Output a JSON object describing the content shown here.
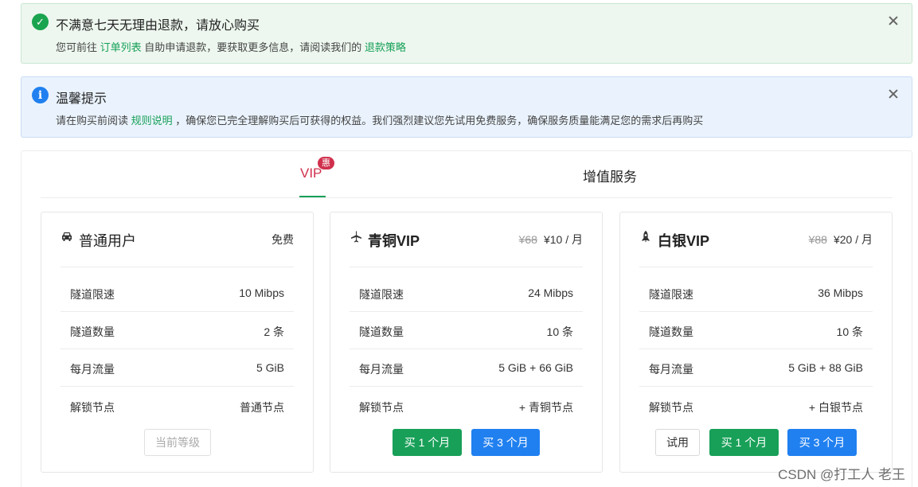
{
  "alerts": {
    "success": {
      "title": "不满意七天无理由退款，请放心购买",
      "desc_1": "您可前往",
      "link_1": "订单列表",
      "desc_2": "自助申请退款，要获取更多信息，请阅读我们的",
      "link_2": "退款策略"
    },
    "info": {
      "icon": "i",
      "title": "温馨提示",
      "desc_1": "请在购买前阅读",
      "link_1": "规则说明",
      "desc_2": "，确保您已完全理解购买后可获得的权益。我们强烈建议您先试用免费服务，确保服务质量能满足您的需求后再购买"
    }
  },
  "tabs": {
    "vip": "VIP",
    "vip_badge": "惠",
    "value_added": "增值服务"
  },
  "plans": [
    {
      "icon": "car-icon",
      "title": "普通用户",
      "price": "免费",
      "rows": [
        {
          "label": "隧道限速",
          "value": "10 Mibps"
        },
        {
          "label": "隧道数量",
          "value": "2 条"
        },
        {
          "label": "每月流量",
          "value": "5 GiB"
        },
        {
          "label": "解锁节点",
          "value": "普通节点"
        }
      ],
      "buttons": {
        "current": "当前等级"
      }
    },
    {
      "icon": "airplane-icon",
      "title": "青铜VIP",
      "old_price": "¥68",
      "price": "¥10 / 月",
      "rows": [
        {
          "label": "隧道限速",
          "value": "24 Mibps"
        },
        {
          "label": "隧道数量",
          "value": "10 条"
        },
        {
          "label": "每月流量",
          "value": "5 GiB + 66 GiB"
        },
        {
          "label": "解锁节点",
          "value": "+ 青铜节点"
        }
      ],
      "buttons": {
        "buy_1": "买 1 个月",
        "buy_3": "买 3 个月"
      }
    },
    {
      "icon": "rocket-icon",
      "title": "白银VIP",
      "old_price": "¥88",
      "price": "¥20 / 月",
      "rows": [
        {
          "label": "隧道限速",
          "value": "36 Mibps"
        },
        {
          "label": "隧道数量",
          "value": "10 条"
        },
        {
          "label": "每月流量",
          "value": "5 GiB + 88 GiB"
        },
        {
          "label": "解锁节点",
          "value": "+ 白银节点"
        }
      ],
      "buttons": {
        "trial": "试用",
        "buy_1": "买 1 个月",
        "buy_3": "买 3 个月"
      }
    }
  ],
  "watermark": "CSDN @打工人 老王",
  "colors": {
    "success": "#18a058",
    "info": "#2080f0",
    "vip_accent": "#d0304d"
  }
}
